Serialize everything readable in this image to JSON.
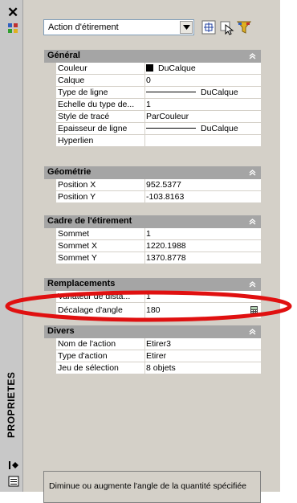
{
  "palette": {
    "vertical_title": "PROPRIETES"
  },
  "toolbar": {
    "selection_combo": "Action d'étirement"
  },
  "groups": {
    "general": {
      "title": "Général",
      "rows": [
        {
          "label": "Couleur",
          "value": "DuCalque"
        },
        {
          "label": "Calque",
          "value": "0"
        },
        {
          "label": "Type de ligne",
          "value": "DuCalque"
        },
        {
          "label": "Echelle du type de...",
          "value": "1"
        },
        {
          "label": "Style de tracé",
          "value": "ParCouleur"
        },
        {
          "label": "Epaisseur de ligne",
          "value": "DuCalque"
        },
        {
          "label": "Hyperlien",
          "value": ""
        }
      ]
    },
    "geometrie": {
      "title": "Géométrie",
      "rows": [
        {
          "label": "Position X",
          "value": "952.5377"
        },
        {
          "label": "Position Y",
          "value": "-103.8163"
        }
      ]
    },
    "cadre": {
      "title": "Cadre de l'étirement",
      "rows": [
        {
          "label": "Sommet",
          "value": "1"
        },
        {
          "label": "Sommet X",
          "value": "1220.1988"
        },
        {
          "label": "Sommet Y",
          "value": "1370.8778"
        }
      ]
    },
    "remplacements": {
      "title": "Remplacements",
      "rows": [
        {
          "label": "Variateur de dista...",
          "value": "1"
        },
        {
          "label": "Décalage d'angle",
          "value": "180"
        }
      ]
    },
    "divers": {
      "title": "Divers",
      "rows": [
        {
          "label": "Nom de l'action",
          "value": "Etirer3"
        },
        {
          "label": "Type d'action",
          "value": "Etirer"
        },
        {
          "label": "Jeu de sélection",
          "value": "8 objets"
        }
      ]
    }
  },
  "description": "Diminue ou augmente l'angle de la quantité spécifiée",
  "colors": {
    "panel_bg": "#d4d0c8",
    "group_header": "#a5a5a5",
    "annotation_ellipse": "#e01010"
  }
}
